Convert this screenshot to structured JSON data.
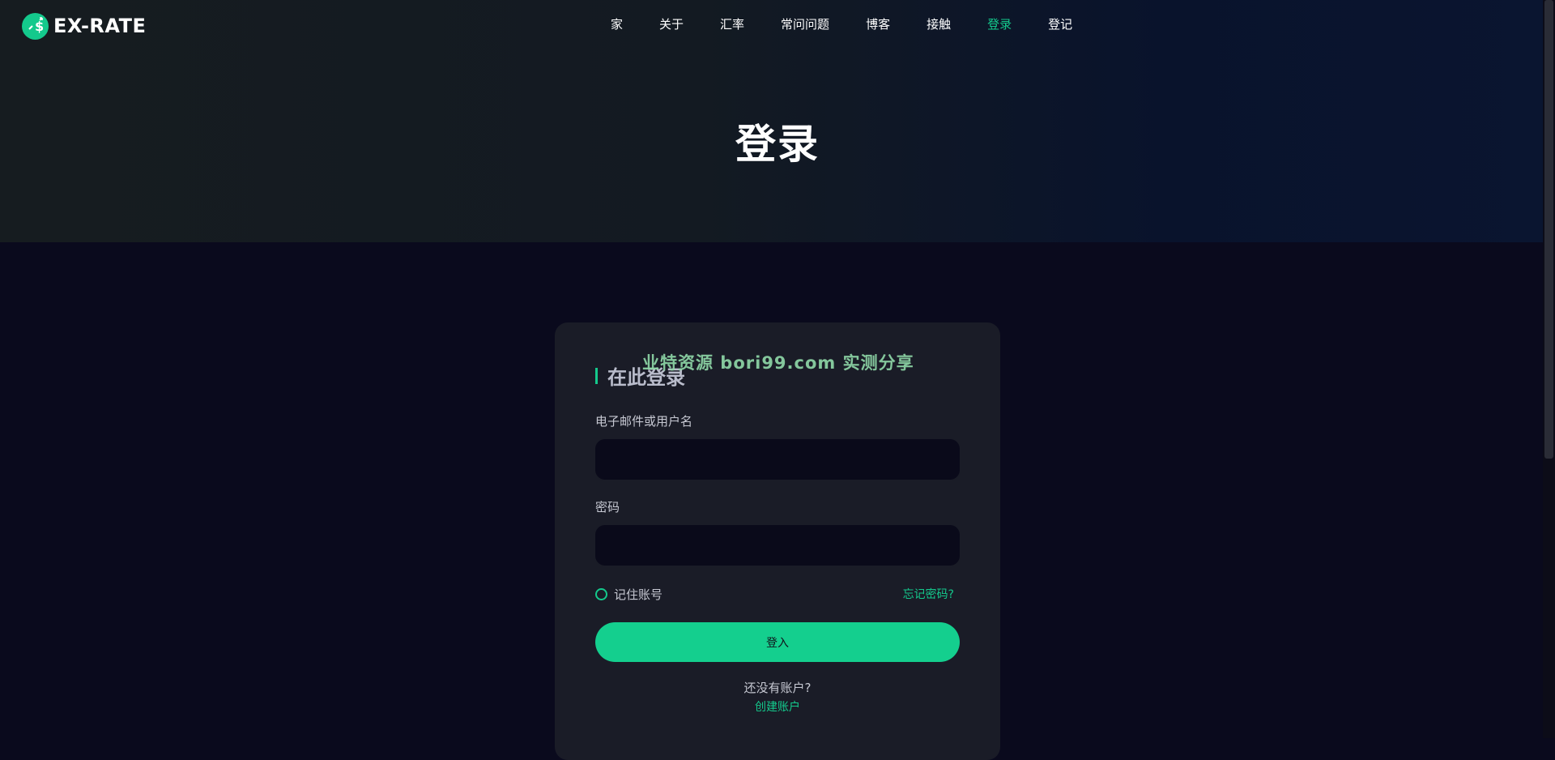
{
  "brand": {
    "name": "EX-RATE",
    "accent": "#14c98c"
  },
  "nav": {
    "items": [
      {
        "label": "家"
      },
      {
        "label": "关于"
      },
      {
        "label": "汇率"
      },
      {
        "label": "常问问题"
      },
      {
        "label": "博客"
      },
      {
        "label": "接触"
      },
      {
        "label": "登录",
        "active": true
      },
      {
        "label": "登记"
      }
    ]
  },
  "hero": {
    "title": "登录"
  },
  "login_card": {
    "heading": "在此登录",
    "watermark": "业特资源 bori99.com 实测分享",
    "email_label": "电子邮件或用户名",
    "email_value": "",
    "password_label": "密码",
    "password_value": "",
    "remember_label": "记住账号",
    "forgot_label": "忘记密码?",
    "submit_label": "登入",
    "no_account_text": "还没有账户?",
    "create_account_label": "创建账户"
  },
  "icons": {
    "logo": "dollar-exchange-icon",
    "remember": "radio-unchecked-icon"
  }
}
